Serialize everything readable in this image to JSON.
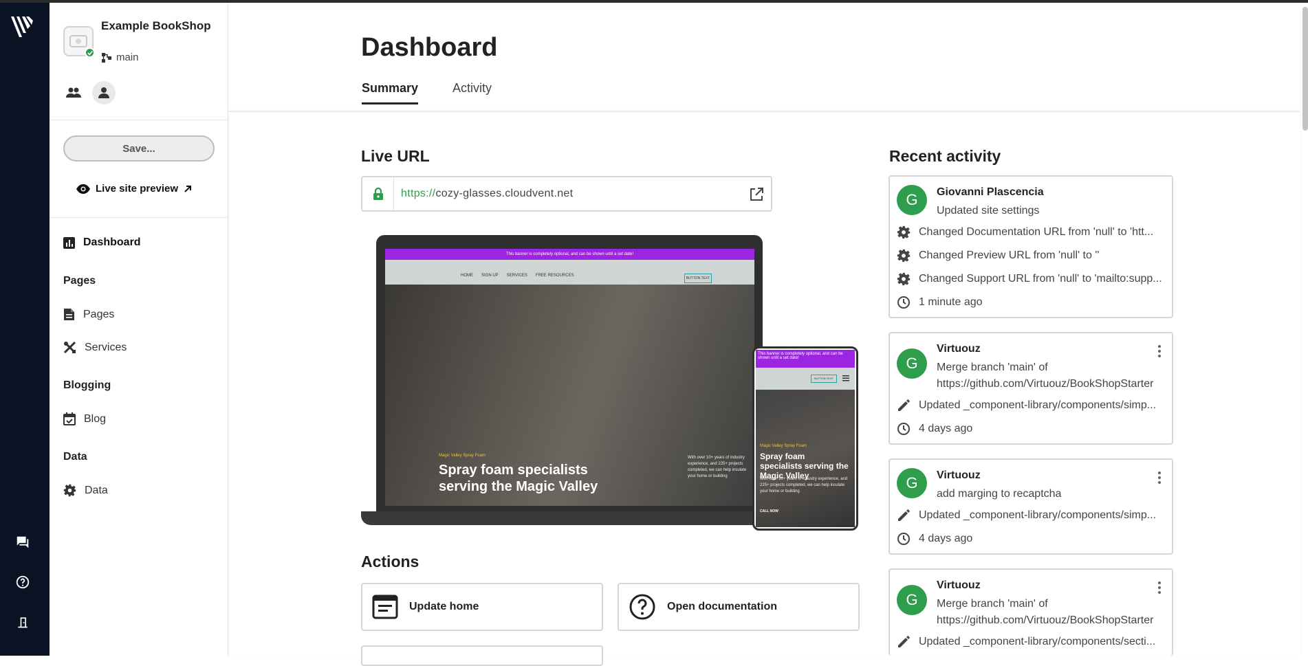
{
  "sidebar": {
    "site_name": "Example BookShop",
    "branch": "main",
    "save_label": "Save...",
    "preview_label": "Live site preview",
    "nav": {
      "dashboard": "Dashboard",
      "group_pages": "Pages",
      "pages": "Pages",
      "services": "Services",
      "group_blogging": "Blogging",
      "blog": "Blog",
      "group_data": "Data",
      "data": "Data"
    }
  },
  "header": {
    "title": "Dashboard",
    "tabs": [
      "Summary",
      "Activity"
    ],
    "active_tab": "Summary"
  },
  "live_url": {
    "title": "Live URL",
    "protocol": "https://",
    "host": "cozy-glasses.cloudvent.net"
  },
  "preview": {
    "banner": "This banner is completely optional, and can be shown until a set date!",
    "hero_eyebrow": "Magic Valley Spray Foam",
    "hero_title": "Spray foam specialists serving the Magic Valley",
    "hero_blurb": "With over 10+ years of industry experience, and 225+ projects completed, we can help insulate your home or building",
    "cta": "CALL NOW",
    "nav_links": [
      "HOME",
      "SIGN UP",
      "SERVICES",
      "FREE RESOURCES"
    ],
    "button_text": "BUTTON TEXT"
  },
  "actions": {
    "title": "Actions",
    "items": [
      "Update home",
      "Open documentation"
    ]
  },
  "recent_activity": {
    "title": "Recent activity",
    "entries": [
      {
        "avatar": "G",
        "author": "Giovanni Plascencia",
        "summary": "Updated site settings",
        "changes": [
          "Changed Documentation URL from 'null' to 'htt...",
          "Changed Preview URL from 'null' to ''",
          "Changed Support URL from 'null' to 'mailto:supp..."
        ],
        "time": "1 minute ago"
      },
      {
        "avatar": "G",
        "author": "Virtuouz",
        "summary": "Merge branch 'main' of https://github.com/Virtuouz/BookShopStarter",
        "changes": [
          "Updated _component-library/components/simp..."
        ],
        "time": "4 days ago"
      },
      {
        "avatar": "G",
        "author": "Virtuouz",
        "summary": "add marging to recaptcha",
        "changes": [
          "Updated _component-library/components/simp..."
        ],
        "time": "4 days ago"
      },
      {
        "avatar": "G",
        "author": "Virtuouz",
        "summary": "Merge branch 'main' of https://github.com/Virtuouz/BookShopStarter",
        "changes": [
          "Updated _component-library/components/secti..."
        ],
        "time": ""
      }
    ]
  },
  "colors": {
    "rail": "#0a1324",
    "success": "#2e9e4d",
    "promo": "#9b25e0",
    "border": "#d6d6d6"
  }
}
